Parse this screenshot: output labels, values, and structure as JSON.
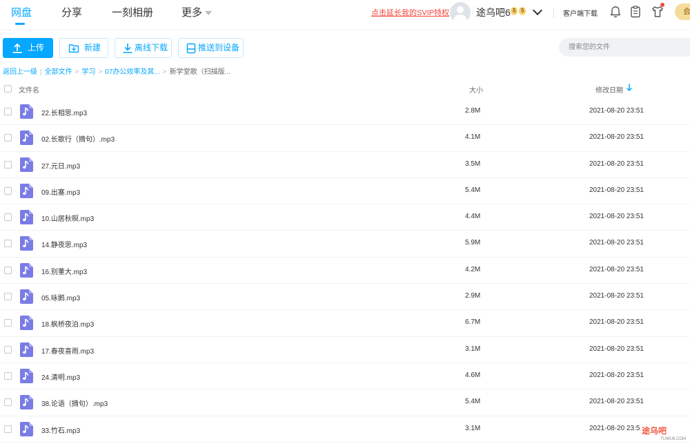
{
  "nav": {
    "tabs": [
      {
        "label": "网盘",
        "active": true
      },
      {
        "label": "分享",
        "active": false
      },
      {
        "label": "一刻相册",
        "active": false
      },
      {
        "label": "更多",
        "active": false
      }
    ],
    "svip_link": "点击延长我的SVIP特权",
    "username": "途乌吧6",
    "badges": [
      "5",
      "5"
    ],
    "client_download": "客户端下载",
    "vip_label": "会",
    "icons": [
      "bell-icon",
      "clipboard-icon",
      "tshirt-icon"
    ]
  },
  "toolbar": {
    "upload": "上传",
    "new": "新建",
    "offline_download": "离线下载",
    "push_to_device": "推送到设备",
    "search_placeholder": "搜索您的文件"
  },
  "breadcrumb": {
    "back": "返回上一级",
    "items": [
      "全部文件",
      "学习",
      "07办公效率及其..."
    ],
    "current": "新学堂歌（扫描版..."
  },
  "table": {
    "headers": {
      "name": "文件名",
      "size": "大小",
      "modified": "修改日期"
    },
    "sort": "modified-desc",
    "rows": [
      {
        "name": "22.长相思.mp3",
        "size": "2.8M",
        "date": "2021-08-20 23:51"
      },
      {
        "name": "02.长歌行（摘句）.mp3",
        "size": "4.1M",
        "date": "2021-08-20 23:51"
      },
      {
        "name": "27.元日.mp3",
        "size": "3.5M",
        "date": "2021-08-20 23:51"
      },
      {
        "name": "09.出塞.mp3",
        "size": "5.4M",
        "date": "2021-08-20 23:51"
      },
      {
        "name": "10.山居秋暝.mp3",
        "size": "4.4M",
        "date": "2021-08-20 23:51"
      },
      {
        "name": "14.静夜思.mp3",
        "size": "5.9M",
        "date": "2021-08-20 23:51"
      },
      {
        "name": "16.别董大.mp3",
        "size": "4.2M",
        "date": "2021-08-20 23:51"
      },
      {
        "name": "05.咏鹅.mp3",
        "size": "2.9M",
        "date": "2021-08-20 23:51"
      },
      {
        "name": "18.枫桥夜泊.mp3",
        "size": "6.7M",
        "date": "2021-08-20 23:51"
      },
      {
        "name": "17.春夜喜雨.mp3",
        "size": "3.1M",
        "date": "2021-08-20 23:51"
      },
      {
        "name": "24.清明.mp3",
        "size": "4.6M",
        "date": "2021-08-20 23:51"
      },
      {
        "name": "38.论语（摘句）.mp3",
        "size": "5.4M",
        "date": "2021-08-20 23:51"
      },
      {
        "name": "33.竹石.mp3",
        "size": "3.1M",
        "date": "2021-08-20 23:5"
      }
    ]
  },
  "watermark": {
    "text": "途乌吧",
    "sub": "TUWU8.COM"
  },
  "colors": {
    "accent": "#06a7ff",
    "link_red": "#f2463d",
    "file_icon": "#7a7ce6"
  }
}
